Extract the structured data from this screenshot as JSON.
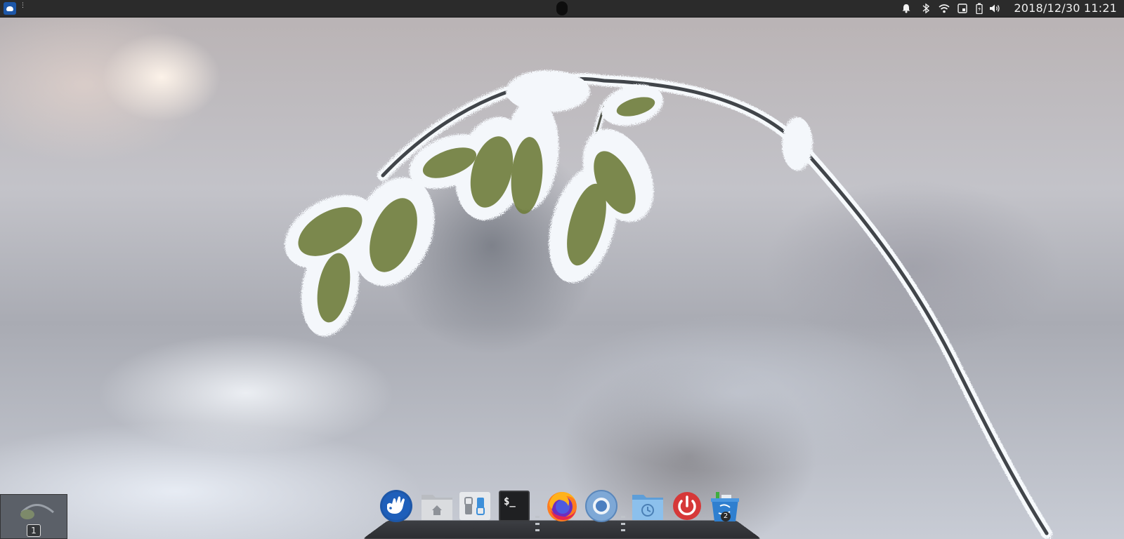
{
  "top_panel": {
    "clock": "2018/12/30 11:21",
    "tray_icons": [
      "bell-icon",
      "bluetooth-icon",
      "wifi-icon",
      "screenshot-icon",
      "battery-icon",
      "volume-icon"
    ]
  },
  "workspace": {
    "number": "1"
  },
  "dock": {
    "items": [
      {
        "name": "deepin-launcher",
        "icon": "deepin-logo-icon"
      },
      {
        "name": "home-folder",
        "icon": "home-folder-icon"
      },
      {
        "name": "control-center",
        "icon": "control-center-icon"
      },
      {
        "name": "terminal",
        "icon": "terminal-icon",
        "glyph": "$_"
      },
      {
        "name": "firefox",
        "icon": "firefox-icon"
      },
      {
        "name": "chromium",
        "icon": "chromium-icon"
      },
      {
        "name": "recent-folder",
        "icon": "recent-folder-icon"
      },
      {
        "name": "shutdown",
        "icon": "power-icon"
      },
      {
        "name": "trash",
        "icon": "trash-icon",
        "badge": "2"
      }
    ]
  },
  "colors": {
    "panel": "#2b2b2b",
    "accent": "#1d57a8",
    "power": "#d63838"
  }
}
